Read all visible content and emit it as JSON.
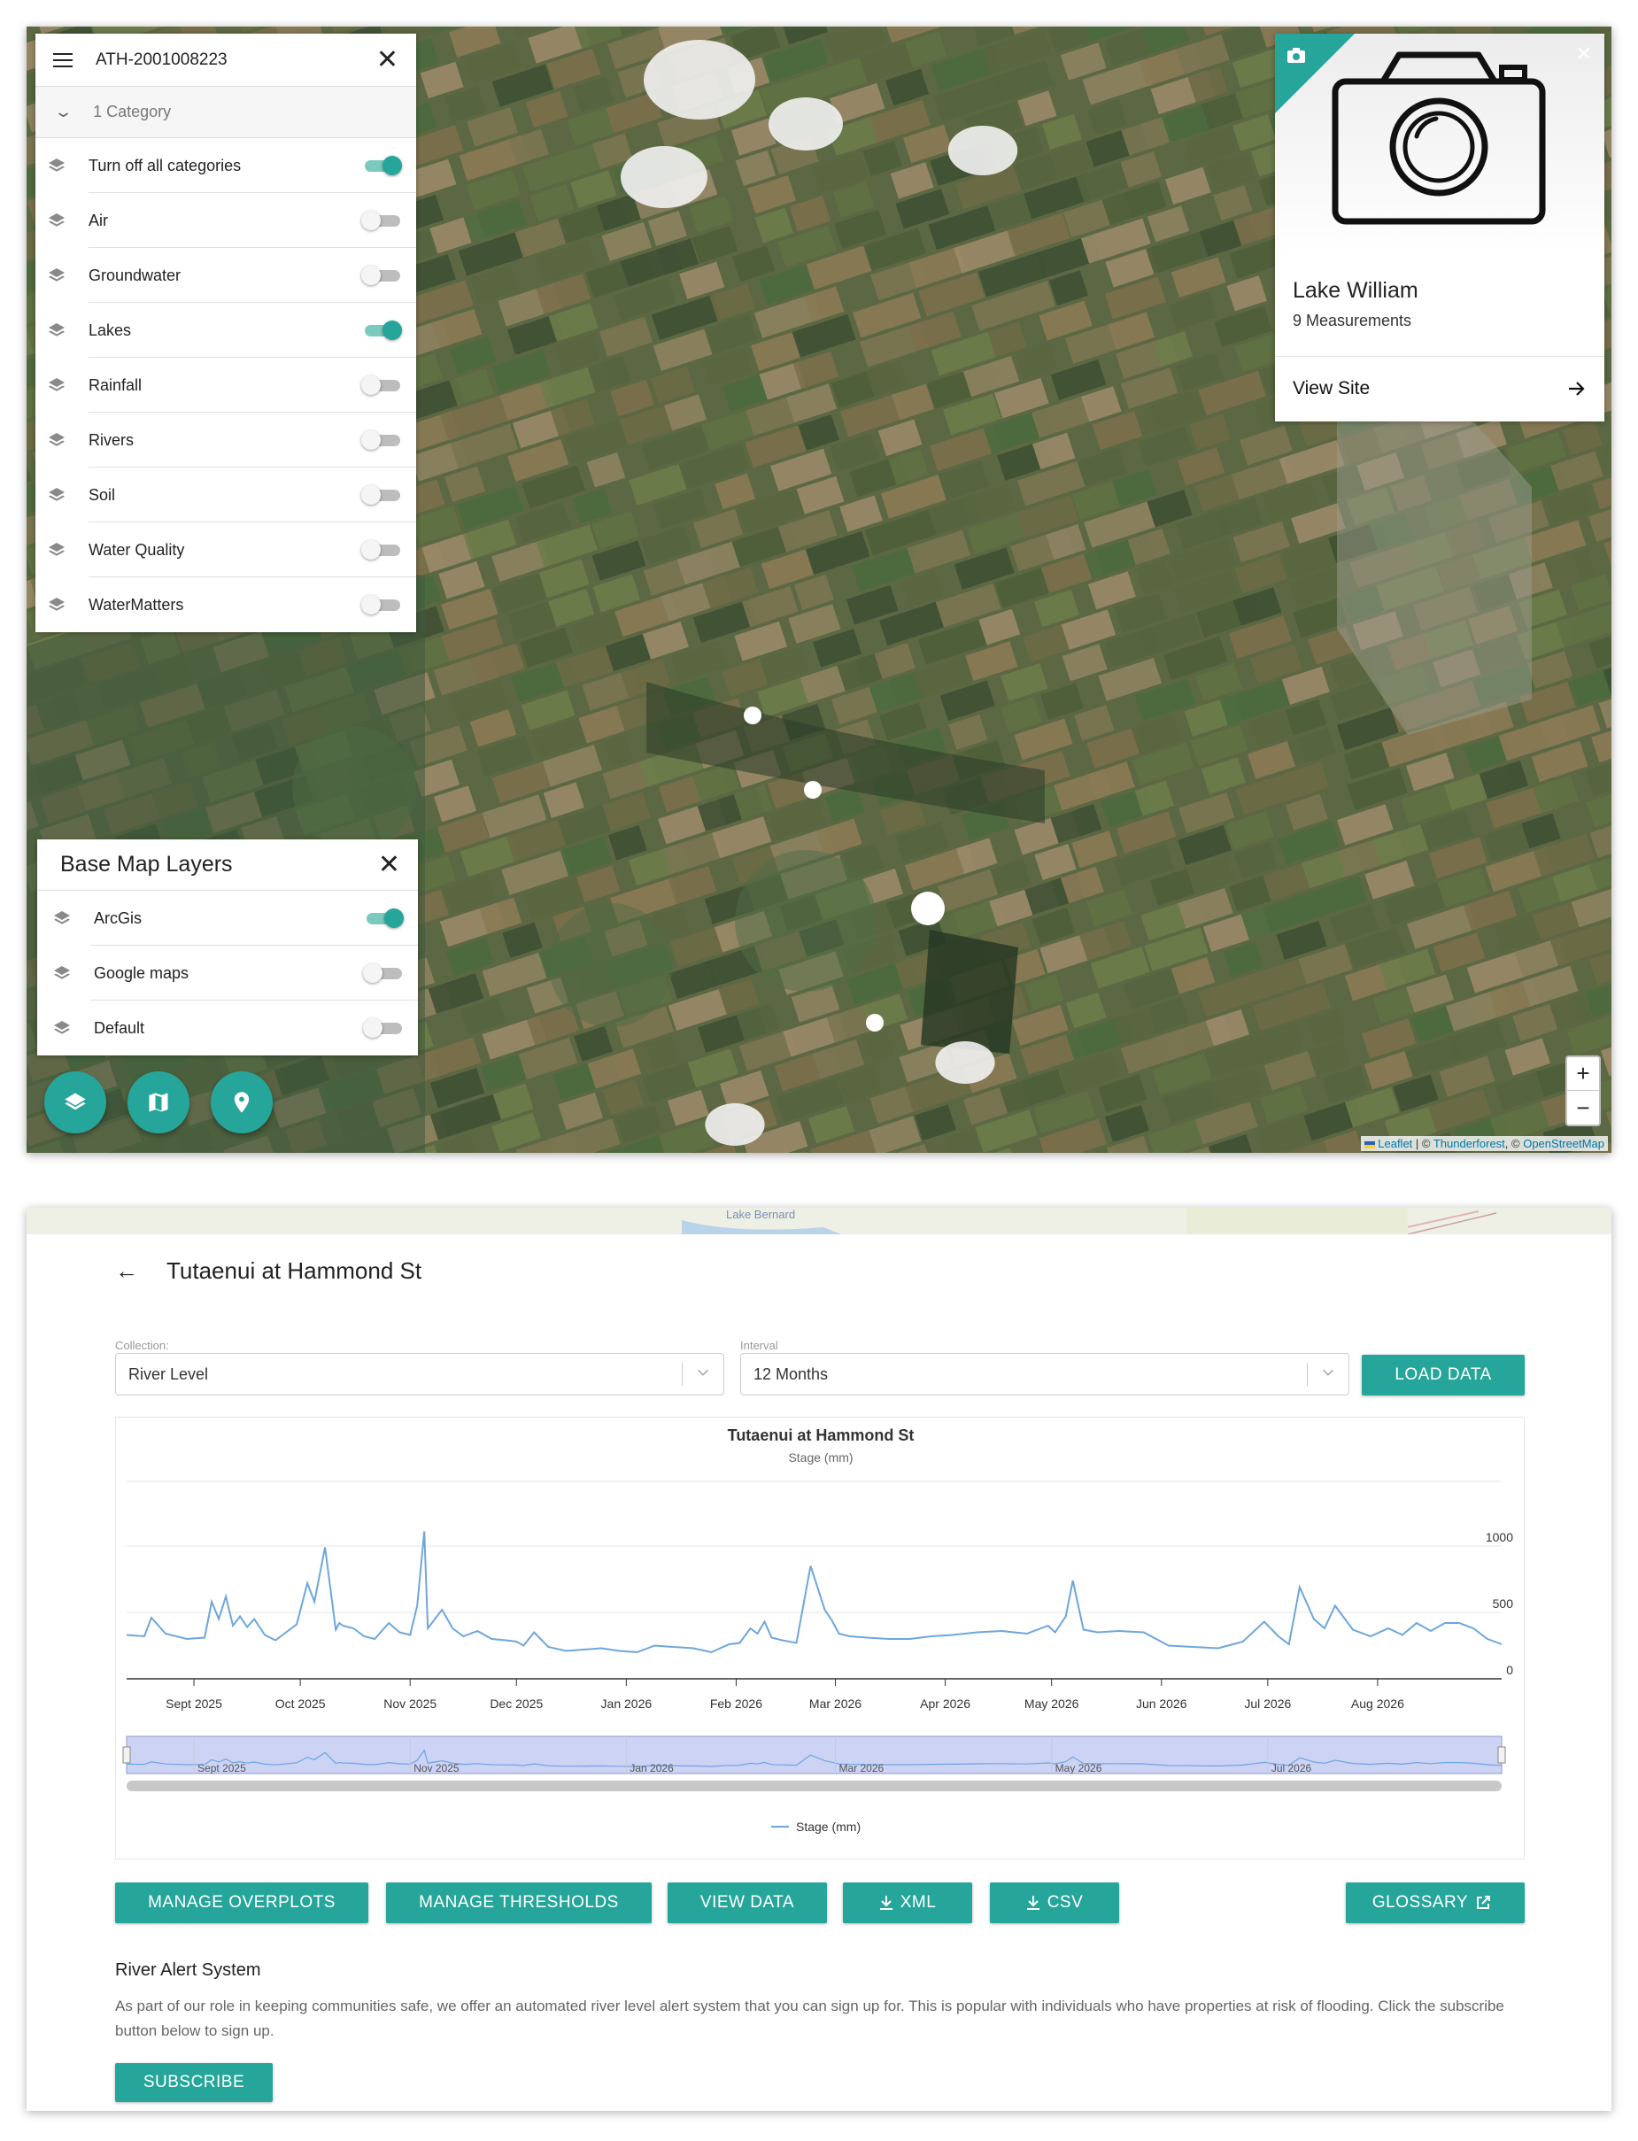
{
  "map_panel": {
    "site_code": "ATH-2001008223",
    "category_count": "1 Category",
    "categories": [
      {
        "label": "Turn off all categories",
        "on": true
      },
      {
        "label": "Air",
        "on": false
      },
      {
        "label": "Groundwater",
        "on": false
      },
      {
        "label": "Lakes",
        "on": true
      },
      {
        "label": "Rainfall",
        "on": false
      },
      {
        "label": "Rivers",
        "on": false
      },
      {
        "label": "Soil",
        "on": false
      },
      {
        "label": "Water Quality",
        "on": false
      },
      {
        "label": "WaterMatters",
        "on": false
      }
    ]
  },
  "base_map": {
    "title": "Base Map Layers",
    "layers": [
      {
        "label": "ArcGis",
        "on": true
      },
      {
        "label": "Google maps",
        "on": false
      },
      {
        "label": "Default",
        "on": false
      }
    ]
  },
  "fabs": [
    {
      "icon": "layers-icon"
    },
    {
      "icon": "map-icon"
    },
    {
      "icon": "location-pin-icon"
    }
  ],
  "site_card": {
    "icon": "camera-icon",
    "name": "Lake William",
    "measurements": "9 Measurements",
    "view_label": "View Site"
  },
  "zoom": {
    "in": "+",
    "out": "−"
  },
  "attribution": {
    "leaflet": "Leaflet",
    "sep1": " | © ",
    "thunderforest": "Thunderforest",
    "sep2": ", © ",
    "osm": "OpenStreetMap"
  },
  "detail": {
    "strip_label": "Lake Bernard",
    "title": "Tutaenui at Hammond St",
    "collection_label": "Collection:",
    "collection_value": "River Level",
    "interval_label": "Interval",
    "interval_value": "12 Months",
    "load_button": "LOAD DATA",
    "buttons": {
      "overplots": "MANAGE OVERPLOTS",
      "thresholds": "MANAGE THRESHOLDS",
      "view_data": "VIEW DATA",
      "xml": "XML",
      "csv": "CSV",
      "glossary": "GLOSSARY"
    },
    "alert_title": "River Alert System",
    "alert_body": "As part of our role in keeping communities safe, we offer an automated river level alert system that you can sign up for. This is popular with individuals who have properties at risk of flooding. Click the subscribe button below to sign up.",
    "subscribe": "SUBSCRIBE"
  },
  "colors": {
    "accent": "#26a69a",
    "line": "#6ea6dc",
    "navigator_fill": "#cdd3f5"
  },
  "chart_data": {
    "type": "line",
    "title": "Tutaenui at Hammond St",
    "subtitle": "Stage (mm)",
    "xlabel": "",
    "ylabel": "",
    "ylim": [
      0,
      1000
    ],
    "y_ticks": [
      "0",
      "500",
      "1000"
    ],
    "x_ticks": [
      "Sept 2025",
      "Oct 2025",
      "Nov 2025",
      "Dec 2025",
      "Jan 2026",
      "Feb 2026",
      "Mar 2026",
      "Apr 2026",
      "May 2026",
      "Jun 2026",
      "Jul 2026",
      "Aug 2026"
    ],
    "navigator_ticks": [
      "Sept 2025",
      "Nov 2025",
      "Jan 2026",
      "Mar 2026",
      "May 2026",
      "Jul 2026"
    ],
    "legend": "Stage (mm)",
    "series": [
      {
        "name": "Stage (mm)",
        "x": [
          "2025-08-13",
          "2025-08-18",
          "2025-08-20",
          "2025-08-24",
          "2025-08-30",
          "2025-09-04",
          "2025-09-06",
          "2025-09-08",
          "2025-09-10",
          "2025-09-12",
          "2025-09-14",
          "2025-09-16",
          "2025-09-18",
          "2025-09-21",
          "2025-09-24",
          "2025-09-27",
          "2025-09-30",
          "2025-10-03",
          "2025-10-05",
          "2025-10-08",
          "2025-10-11",
          "2025-10-12",
          "2025-10-13",
          "2025-10-16",
          "2025-10-19",
          "2025-10-22",
          "2025-10-26",
          "2025-10-29",
          "2025-11-01",
          "2025-11-03",
          "2025-11-05",
          "2025-11-06",
          "2025-11-08",
          "2025-11-10",
          "2025-11-13",
          "2025-11-16",
          "2025-11-20",
          "2025-11-24",
          "2025-11-28",
          "2025-12-01",
          "2025-12-03",
          "2025-12-06",
          "2025-12-10",
          "2025-12-15",
          "2025-12-20",
          "2025-12-25",
          "2025-12-30",
          "2026-01-04",
          "2026-01-09",
          "2026-01-14",
          "2026-01-20",
          "2026-01-25",
          "2026-01-30",
          "2026-02-02",
          "2026-02-05",
          "2026-02-07",
          "2026-02-09",
          "2026-02-11",
          "2026-02-14",
          "2026-02-18",
          "2026-02-22",
          "2026-02-26",
          "2026-02-28",
          "2026-03-02",
          "2026-03-05",
          "2026-03-10",
          "2026-03-16",
          "2026-03-22",
          "2026-03-28",
          "2026-04-03",
          "2026-04-10",
          "2026-04-17",
          "2026-04-24",
          "2026-04-30",
          "2026-05-02",
          "2026-05-05",
          "2026-05-07",
          "2026-05-10",
          "2026-05-14",
          "2026-05-20",
          "2026-05-27",
          "2026-06-03",
          "2026-06-10",
          "2026-06-17",
          "2026-06-24",
          "2026-06-30",
          "2026-07-04",
          "2026-07-07",
          "2026-07-10",
          "2026-07-14",
          "2026-07-17",
          "2026-07-20",
          "2026-07-25",
          "2026-07-30",
          "2026-08-04",
          "2026-08-08",
          "2026-08-12",
          "2026-08-16",
          "2026-08-20",
          "2026-08-24",
          "2026-08-28",
          "2026-09-01",
          "2026-09-05"
        ],
        "values": [
          330,
          320,
          460,
          340,
          300,
          310,
          580,
          450,
          620,
          400,
          470,
          390,
          450,
          330,
          290,
          350,
          410,
          720,
          580,
          990,
          370,
          420,
          400,
          380,
          320,
          300,
          420,
          350,
          330,
          550,
          1110,
          380,
          450,
          520,
          380,
          320,
          360,
          300,
          290,
          280,
          250,
          350,
          240,
          210,
          220,
          230,
          210,
          200,
          250,
          240,
          230,
          200,
          260,
          270,
          380,
          340,
          430,
          310,
          290,
          270,
          850,
          520,
          440,
          340,
          320,
          310,
          300,
          300,
          320,
          330,
          350,
          360,
          340,
          400,
          350,
          470,
          740,
          370,
          350,
          360,
          350,
          250,
          240,
          230,
          280,
          430,
          320,
          260,
          690,
          450,
          380,
          550,
          370,
          320,
          380,
          330,
          420,
          360,
          420,
          420,
          380,
          300,
          260
        ]
      }
    ]
  }
}
